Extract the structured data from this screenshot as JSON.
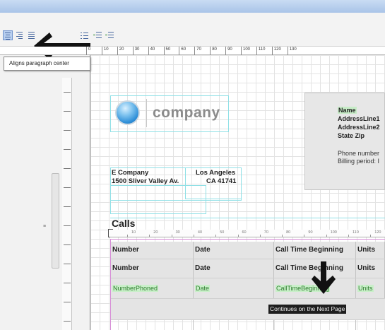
{
  "tooltip": {
    "text": "Aligns paragraph center"
  },
  "toolbar": {
    "buttons": [
      {
        "icon": "align-center-icon",
        "active": true
      },
      {
        "icon": "align-right-icon",
        "active": false
      },
      {
        "icon": "align-justify-icon",
        "active": false
      },
      {
        "icon": "bullet-list-icon",
        "active": false
      },
      {
        "icon": "numbered-list-icon",
        "active": false
      },
      {
        "icon": "decrease-indent-icon",
        "active": false
      },
      {
        "icon": "increase-indent-icon",
        "active": false
      }
    ]
  },
  "ruler": {
    "labels": [
      "0",
      "10",
      "20",
      "30",
      "40",
      "50",
      "60",
      "70",
      "80",
      "90",
      "100",
      "110",
      "120",
      "130"
    ]
  },
  "report": {
    "logo": {
      "text": "company"
    },
    "address": {
      "name": "Name",
      "line1": "AddressLine1",
      "line2": "AddressLine2",
      "state_zip": "State Zip",
      "phone": "Phone number",
      "billing": "Billing period: I"
    },
    "company": {
      "name": "E Company",
      "street": "1500 Sliver Valley Av.",
      "city": "Los Angeles",
      "state_zip": "CA 41741"
    },
    "section_title": "Calls",
    "subruler_labels": [
      "10",
      "20",
      "30",
      "40",
      "50",
      "60",
      "70",
      "80",
      "90",
      "100",
      "110",
      "120"
    ],
    "table": {
      "headers": [
        "Number",
        "Date",
        "Call Time Beginning",
        "Units"
      ],
      "fields": [
        "NumberPhoned",
        "Date",
        "CallTimeBeginning",
        "Units"
      ]
    },
    "continues_text": "Continues on the Next Page"
  }
}
